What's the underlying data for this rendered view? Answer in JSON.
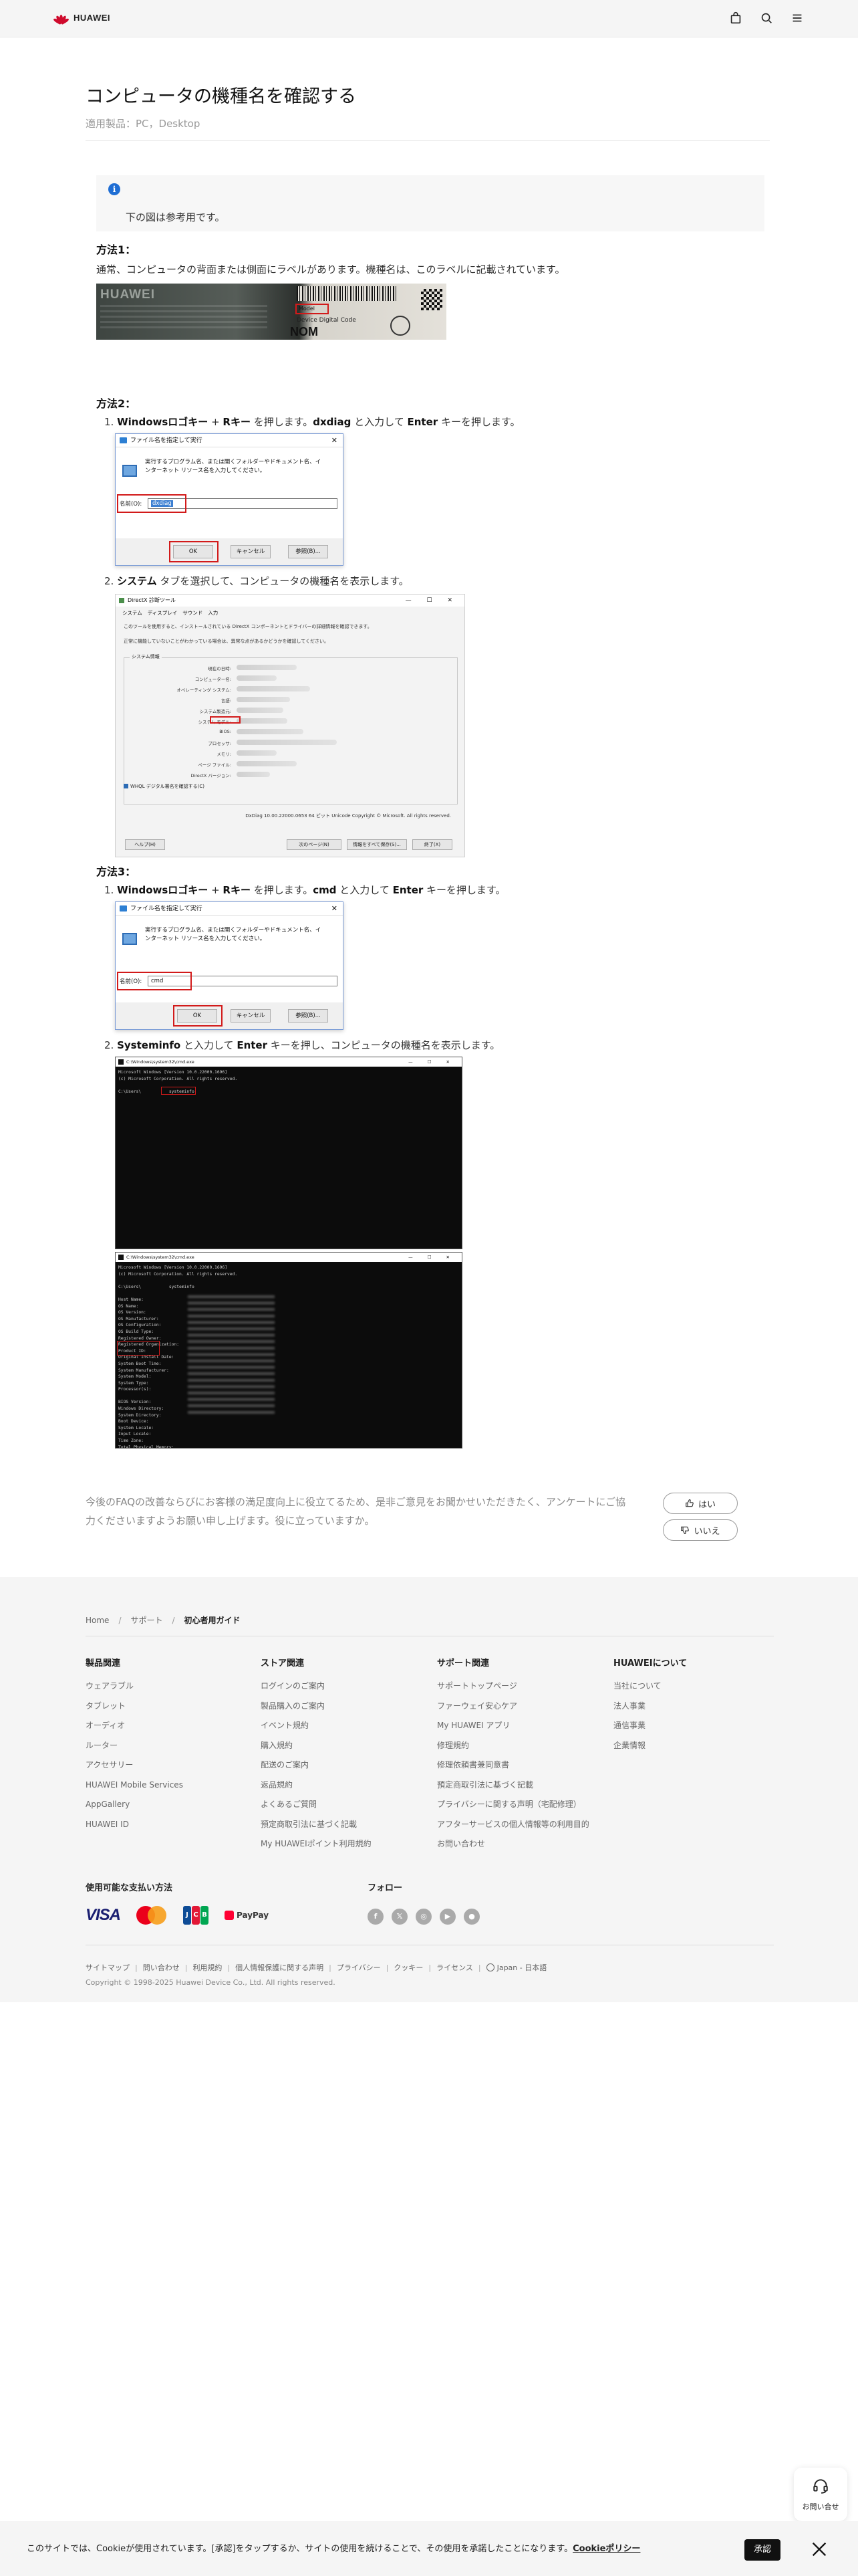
{
  "brand": {
    "name": "HUAWEI",
    "color": "#cf0a2c"
  },
  "header": {
    "icons": [
      "bag-icon",
      "search-icon",
      "menu-icon"
    ]
  },
  "article": {
    "title": "コンピュータの機種名を確認する",
    "applies_to": "適用製品：PC，Desktop",
    "note": "下の図は参考用です。",
    "method1": {
      "heading": "方法1：",
      "text": "通常、コンピュータの背面または側面にラベルがあります。機種名は、このラベルに記載されています。"
    },
    "method2": {
      "heading": "方法2：",
      "step1": {
        "num": "1.",
        "a": "Windowsロゴキー",
        "b": " + ",
        "c": "Rキー",
        "d": " を押します。",
        "e": "dxdiag",
        "f": " と入力して ",
        "g": "Enter",
        "h": " キーを押します。"
      },
      "step2": {
        "num": "2.",
        "a": "システム",
        "b": " タブを選択して、コンピュータの機種名を表示します。"
      }
    },
    "method3": {
      "heading": "方法3：",
      "step1": {
        "num": "1.",
        "a": "Windowsロゴキー",
        "b": " + ",
        "c": "Rキー",
        "d": " を押します。",
        "e": "cmd",
        "f": " と入力して ",
        "g": "Enter",
        "h": " キーを押します。"
      },
      "step2": {
        "num": "2.",
        "a": "Systeminfo",
        "b": " と入力して ",
        "c": "Enter",
        "d": " キーを押し、コンピュータの機種名を表示します。"
      }
    }
  },
  "screens": {
    "photo": {
      "brand": "HUAWEI",
      "model": "Model",
      "device_code": "Device Digital Code",
      "nom": "NOM"
    },
    "run": {
      "title": "ファイル名を指定して実行",
      "desc1": "実行するプログラム名、または開くフォルダーやドキュメント名、イ",
      "desc2": "ンターネット リソース名を入力してください。",
      "label": "名前(O):",
      "value_dxdiag": "dxdiag",
      "value_cmd": "cmd",
      "ok": "OK",
      "cancel": "キャンセル",
      "browse": "参照(B)..."
    },
    "dxdiag": {
      "title": "DirectX 診断ツール",
      "tabs": [
        "システム",
        "ディスプレイ",
        "サウンド",
        "入力"
      ],
      "info1": "このツールを使用すると、インストールされている DirectX コンポーネントとドライバーの詳細情報を確認できます。",
      "info2": "正常に機能していないことがわかっている場合は、異常な点があるかどうかを確認してください。",
      "section": "システム情報",
      "rows": [
        "現在の日時:",
        "コンピューター名:",
        "オペレーティング システム:",
        "言語:",
        "システム製造元:",
        "システム モデル:",
        "BIOS:",
        "プロセッサ:",
        "メモリ:",
        "ページ ファイル:",
        "DirectX バージョン:"
      ],
      "checkbox": "WHQL デジタル署名を確認する(C)",
      "copyright": "DxDiag 10.00.22000.0653 64 ビット Unicode  Copyright © Microsoft. All rights reserved.",
      "buttons": [
        "ヘルプ(H)",
        "次のページ(N)",
        "情報をすべて保存(S)...",
        "終了(X)"
      ]
    },
    "cmd": {
      "title": "C:\\Windows\\system32\\cmd.exe",
      "banner1": "Microsoft Windows [Version 10.0.22000.1696]",
      "banner2": "(c) Microsoft Corporation. All rights reserved.",
      "prompt": "C:\\Users\\",
      "command": "systeminfo",
      "fields": [
        "Host Name:",
        "OS Name:",
        "OS Version:",
        "OS Manufacturer:",
        "OS Configuration:",
        "OS Build Type:",
        "Registered Owner:",
        "Registered Organization:",
        "Product ID:",
        "Original Install Date:",
        "System Boot Time:",
        "System Manufacturer:",
        "System Model:",
        "System Type:",
        "Processor(s):",
        "",
        "BIOS Version:",
        "Windows Directory:",
        "System Directory:",
        "Boot Device:",
        "System Locale:",
        "Input Locale:",
        "Time Zone:",
        "Total Physical Memory:",
        "Available Physical Memory:"
      ]
    }
  },
  "feedback": {
    "text": "今後のFAQの改善ならびにお客様の満足度向上に役立てるため、是非ご意見をお聞かせいただきたく、アンケートにご協力くださいますようお願い申し上げます。役に立っていますか。",
    "yes": "はい",
    "no": "いいえ"
  },
  "footer": {
    "breadcrumb": [
      "Home",
      "サポート",
      "初心者用ガイド"
    ],
    "columns": [
      {
        "title": "製品関連",
        "links": [
          "ウェアラブル",
          "タブレット",
          "オーディオ",
          "ルーター",
          "アクセサリー",
          "HUAWEI Mobile Services",
          "AppGallery",
          "HUAWEI ID"
        ]
      },
      {
        "title": "ストア関連",
        "links": [
          "ログインのご案内",
          "製品購入のご案内",
          "イベント規約",
          "購入規約",
          "配送のご案内",
          "返品規約",
          "よくあるご質問",
          "預定商取引法に基づく記載",
          "My HUAWEIポイント利用規約"
        ]
      },
      {
        "title": "サポート関連",
        "links": [
          "サポートトップページ",
          "ファーウェイ安心ケア",
          "My HUAWEI アプリ",
          "修理規約",
          "修理依頼書兼同意書",
          "預定商取引法に基づく記載",
          "プライバシーに関する声明（宅配修理）",
          "アフターサービスの個人情報等の利用目的",
          "お問い合わせ"
        ]
      },
      {
        "title": "HUAWEIについて",
        "links": [
          "当社について",
          "法人事業",
          "通信事業",
          "企業情報"
        ]
      }
    ],
    "payment_heading": "使用可能な支払い方法",
    "payments": [
      "VISA",
      "JCB",
      "PayPay"
    ],
    "follow_heading": "フォロー",
    "social": [
      "facebook-icon",
      "x-icon",
      "instagram-icon",
      "youtube-icon",
      "line-icon"
    ],
    "legal": [
      "サイトマップ",
      "問い合わせ",
      "利用規約",
      "個人情報保護に関する声明",
      "プライバシー",
      "クッキー",
      "ライセンス"
    ],
    "locale": "Japan - 日本語",
    "copyright": "Copyright © 1998-2025 Huawei Device Co., Ltd. All rights reserved."
  },
  "contact": {
    "label": "お問い合せ"
  },
  "cookie": {
    "text": "このサイトでは、Cookieが使用されています。[承認]をタップするか、サイトの使用を続けることで、その使用を承諾したことになります。",
    "policy_link": "Cookieポリシー",
    "accept": "承認"
  }
}
